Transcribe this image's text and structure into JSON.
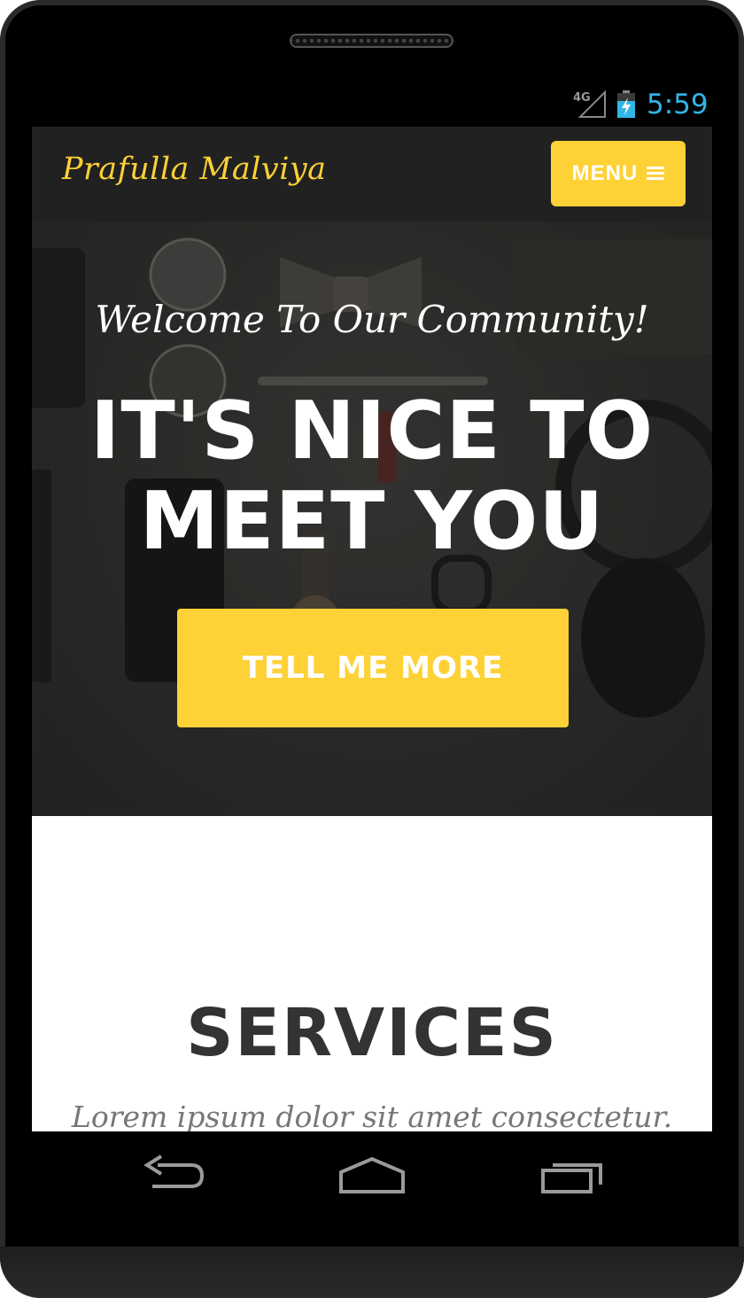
{
  "status_bar": {
    "network": "4G",
    "time": "5:59",
    "time_color": "#33b5e5"
  },
  "navbar": {
    "brand": "Prafulla Malviya",
    "menu_label": "MENU",
    "menu_icon": "hamburger-icon"
  },
  "hero": {
    "lead": "Welcome To Our Community!",
    "heading": "IT'S NICE TO MEET YOU",
    "cta_label": "TELL ME MORE"
  },
  "services": {
    "title": "SERVICES",
    "subtitle": "Lorem ipsum dolor sit amet consectetur."
  },
  "nav_keys": {
    "back": "back-icon",
    "home": "home-icon",
    "recents": "recents-icon"
  },
  "colors": {
    "accent": "#fed136",
    "navbar": "#212121",
    "heading": "#333333"
  }
}
